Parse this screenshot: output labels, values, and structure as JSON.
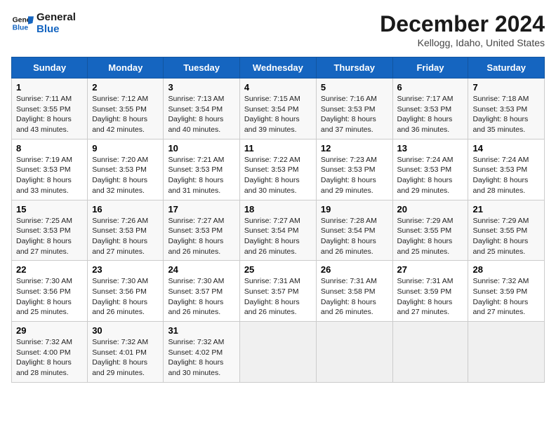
{
  "logo": {
    "line1": "General",
    "line2": "Blue"
  },
  "title": "December 2024",
  "subtitle": "Kellogg, Idaho, United States",
  "weekdays": [
    "Sunday",
    "Monday",
    "Tuesday",
    "Wednesday",
    "Thursday",
    "Friday",
    "Saturday"
  ],
  "weeks": [
    [
      {
        "day": "1",
        "sunrise": "Sunrise: 7:11 AM",
        "sunset": "Sunset: 3:55 PM",
        "daylight": "Daylight: 8 hours and 43 minutes."
      },
      {
        "day": "2",
        "sunrise": "Sunrise: 7:12 AM",
        "sunset": "Sunset: 3:55 PM",
        "daylight": "Daylight: 8 hours and 42 minutes."
      },
      {
        "day": "3",
        "sunrise": "Sunrise: 7:13 AM",
        "sunset": "Sunset: 3:54 PM",
        "daylight": "Daylight: 8 hours and 40 minutes."
      },
      {
        "day": "4",
        "sunrise": "Sunrise: 7:15 AM",
        "sunset": "Sunset: 3:54 PM",
        "daylight": "Daylight: 8 hours and 39 minutes."
      },
      {
        "day": "5",
        "sunrise": "Sunrise: 7:16 AM",
        "sunset": "Sunset: 3:53 PM",
        "daylight": "Daylight: 8 hours and 37 minutes."
      },
      {
        "day": "6",
        "sunrise": "Sunrise: 7:17 AM",
        "sunset": "Sunset: 3:53 PM",
        "daylight": "Daylight: 8 hours and 36 minutes."
      },
      {
        "day": "7",
        "sunrise": "Sunrise: 7:18 AM",
        "sunset": "Sunset: 3:53 PM",
        "daylight": "Daylight: 8 hours and 35 minutes."
      }
    ],
    [
      {
        "day": "8",
        "sunrise": "Sunrise: 7:19 AM",
        "sunset": "Sunset: 3:53 PM",
        "daylight": "Daylight: 8 hours and 33 minutes."
      },
      {
        "day": "9",
        "sunrise": "Sunrise: 7:20 AM",
        "sunset": "Sunset: 3:53 PM",
        "daylight": "Daylight: 8 hours and 32 minutes."
      },
      {
        "day": "10",
        "sunrise": "Sunrise: 7:21 AM",
        "sunset": "Sunset: 3:53 PM",
        "daylight": "Daylight: 8 hours and 31 minutes."
      },
      {
        "day": "11",
        "sunrise": "Sunrise: 7:22 AM",
        "sunset": "Sunset: 3:53 PM",
        "daylight": "Daylight: 8 hours and 30 minutes."
      },
      {
        "day": "12",
        "sunrise": "Sunrise: 7:23 AM",
        "sunset": "Sunset: 3:53 PM",
        "daylight": "Daylight: 8 hours and 29 minutes."
      },
      {
        "day": "13",
        "sunrise": "Sunrise: 7:24 AM",
        "sunset": "Sunset: 3:53 PM",
        "daylight": "Daylight: 8 hours and 29 minutes."
      },
      {
        "day": "14",
        "sunrise": "Sunrise: 7:24 AM",
        "sunset": "Sunset: 3:53 PM",
        "daylight": "Daylight: 8 hours and 28 minutes."
      }
    ],
    [
      {
        "day": "15",
        "sunrise": "Sunrise: 7:25 AM",
        "sunset": "Sunset: 3:53 PM",
        "daylight": "Daylight: 8 hours and 27 minutes."
      },
      {
        "day": "16",
        "sunrise": "Sunrise: 7:26 AM",
        "sunset": "Sunset: 3:53 PM",
        "daylight": "Daylight: 8 hours and 27 minutes."
      },
      {
        "day": "17",
        "sunrise": "Sunrise: 7:27 AM",
        "sunset": "Sunset: 3:53 PM",
        "daylight": "Daylight: 8 hours and 26 minutes."
      },
      {
        "day": "18",
        "sunrise": "Sunrise: 7:27 AM",
        "sunset": "Sunset: 3:54 PM",
        "daylight": "Daylight: 8 hours and 26 minutes."
      },
      {
        "day": "19",
        "sunrise": "Sunrise: 7:28 AM",
        "sunset": "Sunset: 3:54 PM",
        "daylight": "Daylight: 8 hours and 26 minutes."
      },
      {
        "day": "20",
        "sunrise": "Sunrise: 7:29 AM",
        "sunset": "Sunset: 3:55 PM",
        "daylight": "Daylight: 8 hours and 25 minutes."
      },
      {
        "day": "21",
        "sunrise": "Sunrise: 7:29 AM",
        "sunset": "Sunset: 3:55 PM",
        "daylight": "Daylight: 8 hours and 25 minutes."
      }
    ],
    [
      {
        "day": "22",
        "sunrise": "Sunrise: 7:30 AM",
        "sunset": "Sunset: 3:56 PM",
        "daylight": "Daylight: 8 hours and 25 minutes."
      },
      {
        "day": "23",
        "sunrise": "Sunrise: 7:30 AM",
        "sunset": "Sunset: 3:56 PM",
        "daylight": "Daylight: 8 hours and 26 minutes."
      },
      {
        "day": "24",
        "sunrise": "Sunrise: 7:30 AM",
        "sunset": "Sunset: 3:57 PM",
        "daylight": "Daylight: 8 hours and 26 minutes."
      },
      {
        "day": "25",
        "sunrise": "Sunrise: 7:31 AM",
        "sunset": "Sunset: 3:57 PM",
        "daylight": "Daylight: 8 hours and 26 minutes."
      },
      {
        "day": "26",
        "sunrise": "Sunrise: 7:31 AM",
        "sunset": "Sunset: 3:58 PM",
        "daylight": "Daylight: 8 hours and 26 minutes."
      },
      {
        "day": "27",
        "sunrise": "Sunrise: 7:31 AM",
        "sunset": "Sunset: 3:59 PM",
        "daylight": "Daylight: 8 hours and 27 minutes."
      },
      {
        "day": "28",
        "sunrise": "Sunrise: 7:32 AM",
        "sunset": "Sunset: 3:59 PM",
        "daylight": "Daylight: 8 hours and 27 minutes."
      }
    ],
    [
      {
        "day": "29",
        "sunrise": "Sunrise: 7:32 AM",
        "sunset": "Sunset: 4:00 PM",
        "daylight": "Daylight: 8 hours and 28 minutes."
      },
      {
        "day": "30",
        "sunrise": "Sunrise: 7:32 AM",
        "sunset": "Sunset: 4:01 PM",
        "daylight": "Daylight: 8 hours and 29 minutes."
      },
      {
        "day": "31",
        "sunrise": "Sunrise: 7:32 AM",
        "sunset": "Sunset: 4:02 PM",
        "daylight": "Daylight: 8 hours and 30 minutes."
      },
      null,
      null,
      null,
      null
    ]
  ]
}
